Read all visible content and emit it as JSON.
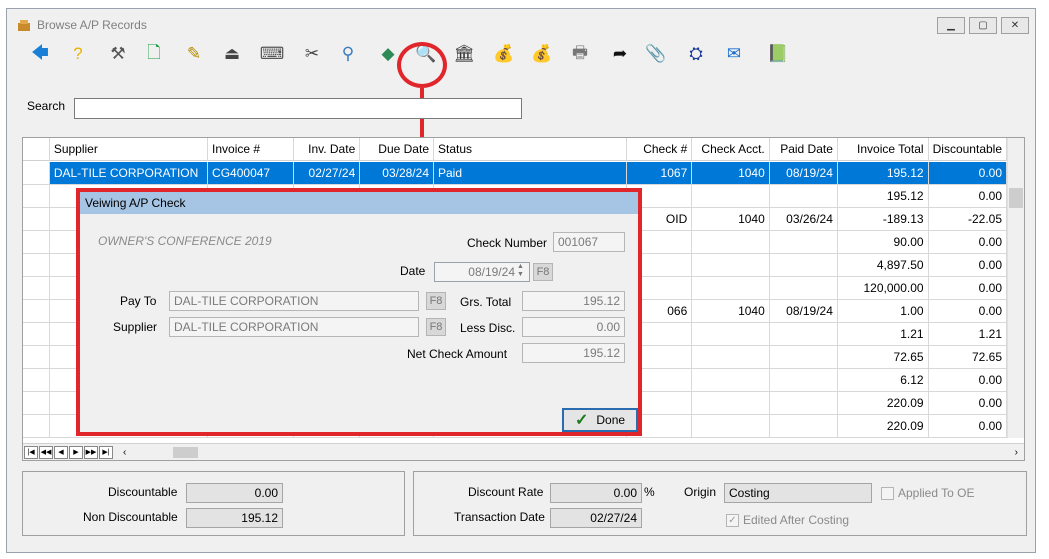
{
  "window": {
    "title": "Browse A/P Records"
  },
  "toolbar": {
    "icons": [
      "back-arrow-icon",
      "help-icon",
      "tools-icon",
      "new-record-icon",
      "edit-icon",
      "eject-icon",
      "keyboard-icon",
      "scissors-icon",
      "search-icon",
      "eraser-icon",
      "view-check-icon",
      "bank-icon",
      "money-bag-icon",
      "money-bag-remove-icon",
      "printer-icon",
      "forward-arrow-icon",
      "paperclip-icon",
      "binoculars-icon",
      "email-icon",
      "ledger-book-icon"
    ]
  },
  "search": {
    "label": "Search",
    "value": ""
  },
  "grid": {
    "headers": [
      "Supplier",
      "Invoice #",
      "Inv. Date",
      "Due Date",
      "Status",
      "Check #",
      "Check Acct.",
      "Paid Date",
      "Invoice Total",
      "Discountable"
    ],
    "rows": [
      [
        "DAL-TILE CORPORATION",
        "CG400047",
        "02/27/24",
        "03/28/24",
        "Paid",
        "1067",
        "1040",
        "08/19/24",
        "195.12",
        "0.00"
      ],
      [
        "",
        "",
        "",
        "",
        "",
        "",
        "",
        "",
        "195.12",
        "0.00"
      ],
      [
        "",
        "",
        "",
        "",
        "",
        "OID",
        "1040",
        "03/26/24",
        "-189.13",
        "-22.05"
      ],
      [
        "",
        "",
        "",
        "",
        "",
        "",
        "",
        "",
        "90.00",
        "0.00"
      ],
      [
        "",
        "",
        "",
        "",
        "",
        "",
        "",
        "",
        "4,897.50",
        "0.00"
      ],
      [
        "",
        "",
        "",
        "",
        "",
        "",
        "",
        "",
        "120,000.00",
        "0.00"
      ],
      [
        "",
        "",
        "",
        "",
        "",
        "066",
        "1040",
        "08/19/24",
        "1.00",
        "0.00"
      ],
      [
        "",
        "",
        "",
        "",
        "",
        "",
        "",
        "",
        "1.21",
        "1.21"
      ],
      [
        "",
        "",
        "",
        "",
        "",
        "",
        "",
        "",
        "72.65",
        "72.65"
      ],
      [
        "",
        "",
        "",
        "",
        "",
        "",
        "",
        "",
        "6.12",
        "0.00"
      ],
      [
        "",
        "",
        "",
        "",
        "",
        "",
        "",
        "",
        "220.09",
        "0.00"
      ],
      [
        "",
        "",
        "",
        "",
        "",
        "",
        "",
        "",
        "220.09",
        "0.00"
      ]
    ]
  },
  "footer": {
    "discountable_label": "Discountable",
    "discountable": "0.00",
    "non_discountable_label": "Non Discountable",
    "non_discountable": "195.12",
    "discount_rate_label": "Discount Rate",
    "discount_rate": "0.00",
    "discount_rate_unit": "%",
    "transaction_date_label": "Transaction Date",
    "transaction_date": "02/27/24",
    "origin_label": "Origin",
    "origin": "Costing",
    "applied_to_oe_label": "Applied To OE",
    "applied_to_oe": false,
    "edited_after_costing_label": "Edited After Costing",
    "edited_after_costing": true
  },
  "dialog": {
    "title": "Veiwing A/P Check",
    "memo": "OWNER'S CONFERENCE 2019",
    "check_number_label": "Check Number",
    "check_number": "001067",
    "date_label": "Date",
    "date": "08/19/24",
    "pay_to_label": "Pay To",
    "pay_to": "DAL-TILE CORPORATION",
    "supplier_label": "Supplier",
    "supplier": "DAL-TILE CORPORATION",
    "grs_total_label": "Grs. Total",
    "grs_total": "195.12",
    "less_disc_label": "Less Disc.",
    "less_disc": "0.00",
    "net_check_label": "Net Check Amount",
    "net_check": "195.12",
    "f8": "F8",
    "done_label": "Done"
  },
  "colors": {
    "highlight": "#e0262b",
    "selection": "#0078d7",
    "dialog_title": "#a6c4e4"
  }
}
